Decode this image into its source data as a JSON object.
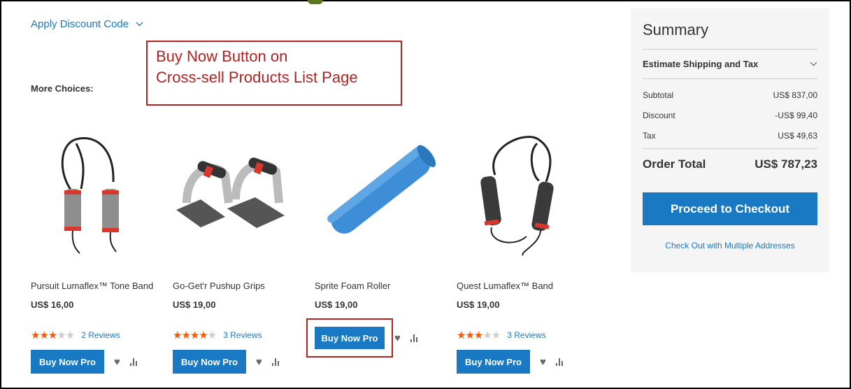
{
  "discount": {
    "label": "Apply Discount Code",
    "chevron_icon": "chevron-down-icon"
  },
  "callout": {
    "line1": "Buy Now Button on",
    "line2": "Cross-sell Products List Page",
    "color": "#b22222"
  },
  "more_choices": "More Choices:",
  "products": [
    {
      "name": "Pursuit Lumaflex™ Tone Band",
      "price": "US$ 16,00",
      "rating": 3,
      "reviews": "2 Reviews",
      "button": "Buy Now Pro"
    },
    {
      "name": "Go-Get'r Pushup Grips",
      "price": "US$ 19,00",
      "rating": 4,
      "reviews": "3 Reviews",
      "button": "Buy Now Pro"
    },
    {
      "name": "Sprite Foam Roller",
      "price": "US$ 19,00",
      "rating": null,
      "reviews": "",
      "button": "Buy Now Pro"
    },
    {
      "name": "Quest Lumaflex™ Band",
      "price": "US$ 19,00",
      "rating": 3,
      "reviews": "3 Reviews",
      "button": "Buy Now Pro"
    }
  ],
  "summary": {
    "title": "Summary",
    "estimate": "Estimate Shipping and Tax",
    "rows": [
      {
        "label": "Subtotal",
        "value": "US$ 837,00"
      },
      {
        "label": "Discount",
        "value": "-US$ 99,40"
      },
      {
        "label": "Tax",
        "value": "US$ 49,63"
      }
    ],
    "total_label": "Order Total",
    "total_value": "US$ 787,23",
    "checkout": "Proceed to Checkout",
    "multi": "Check Out with Multiple Addresses"
  },
  "colors": {
    "accent": "#1979c3",
    "star": "#ff5501",
    "highlight": "#b22222",
    "summary_bg": "#f5f5f5"
  }
}
